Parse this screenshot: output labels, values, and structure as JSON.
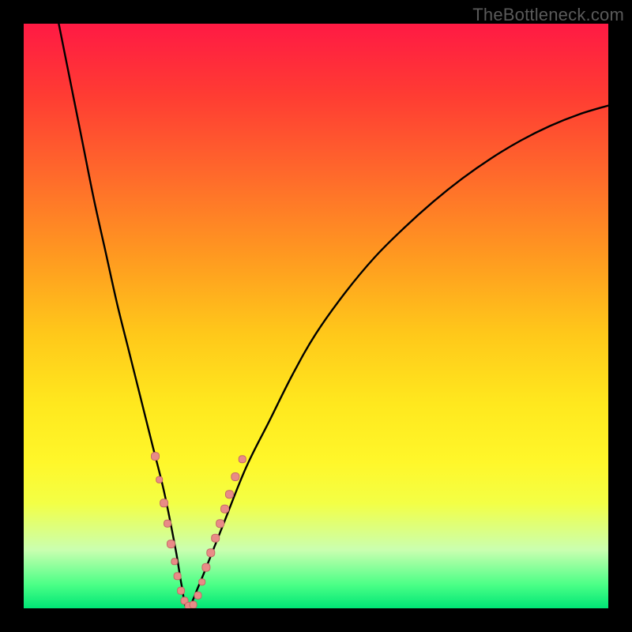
{
  "watermark": "TheBottleneck.com",
  "colors": {
    "frame": "#000000",
    "curve_stroke": "#000000",
    "marker_fill": "#e98b87",
    "marker_stroke": "#c46b66"
  },
  "chart_data": {
    "type": "line",
    "title": "",
    "xlabel": "",
    "ylabel": "",
    "xlim": [
      0,
      100
    ],
    "ylim": [
      0,
      100
    ],
    "grid": false,
    "series": [
      {
        "name": "bottleneck-curve",
        "x": [
          6,
          8,
          10,
          12,
          14,
          16,
          18,
          20,
          22,
          24,
          26,
          27,
          28,
          30,
          34,
          38,
          42,
          46,
          50,
          55,
          60,
          65,
          70,
          75,
          80,
          85,
          90,
          95,
          100
        ],
        "y": [
          100,
          90,
          80,
          70,
          61,
          52,
          44,
          36,
          28,
          20,
          10,
          4,
          0,
          4,
          14,
          24,
          32,
          40,
          47,
          54,
          60,
          65,
          69.5,
          73.5,
          77,
          80,
          82.5,
          84.5,
          86
        ]
      }
    ],
    "markers": [
      {
        "x": 22.5,
        "y": 26,
        "size": 10
      },
      {
        "x": 23.2,
        "y": 22,
        "size": 8
      },
      {
        "x": 24.0,
        "y": 18,
        "size": 10
      },
      {
        "x": 24.6,
        "y": 14.5,
        "size": 9
      },
      {
        "x": 25.2,
        "y": 11,
        "size": 10
      },
      {
        "x": 25.8,
        "y": 8,
        "size": 8
      },
      {
        "x": 26.3,
        "y": 5.5,
        "size": 9
      },
      {
        "x": 26.9,
        "y": 3,
        "size": 9
      },
      {
        "x": 27.5,
        "y": 1.3,
        "size": 9
      },
      {
        "x": 28.2,
        "y": 0.4,
        "size": 9
      },
      {
        "x": 29.0,
        "y": 0.6,
        "size": 9
      },
      {
        "x": 29.8,
        "y": 2.2,
        "size": 9
      },
      {
        "x": 30.5,
        "y": 4.5,
        "size": 8
      },
      {
        "x": 31.2,
        "y": 7,
        "size": 10
      },
      {
        "x": 32.0,
        "y": 9.5,
        "size": 10
      },
      {
        "x": 32.8,
        "y": 12,
        "size": 10
      },
      {
        "x": 33.6,
        "y": 14.5,
        "size": 10
      },
      {
        "x": 34.4,
        "y": 17,
        "size": 10
      },
      {
        "x": 35.2,
        "y": 19.5,
        "size": 10
      },
      {
        "x": 36.2,
        "y": 22.5,
        "size": 10
      },
      {
        "x": 37.4,
        "y": 25.5,
        "size": 9
      }
    ]
  }
}
